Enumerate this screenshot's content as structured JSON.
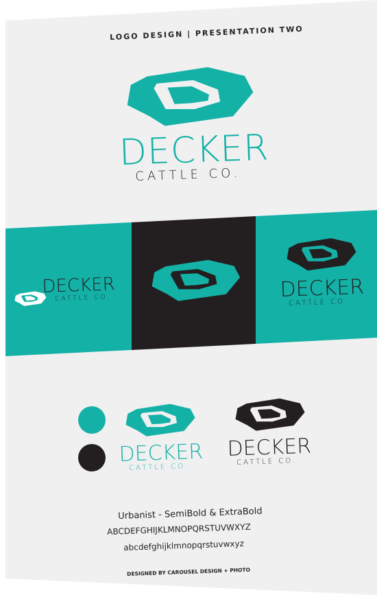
{
  "colors": {
    "teal": "#14b1a7",
    "dark": "#231f20",
    "white": "#ffffff",
    "paper": "#f0f0f1"
  },
  "header": {
    "title": "LOGO DESIGN | PRESENTATION TWO"
  },
  "brand": {
    "name": "DECKER",
    "subtitle": "CATTLE CO."
  },
  "font_sample": {
    "font_name": "Urbanist - SemiBold & ExtraBold",
    "uppercase": "ABCDEFGHIJKLMNOPQRSTUVWXYZ",
    "lowercase": "abcdefghijklmnopqrstuvwxyz"
  },
  "footer": {
    "credit": "DESIGNED BY CAROUSEL DESIGN + PHOTO"
  },
  "icons": {
    "logo_mark": "d-monogram-icon",
    "swatch": "color-swatch-circle"
  }
}
